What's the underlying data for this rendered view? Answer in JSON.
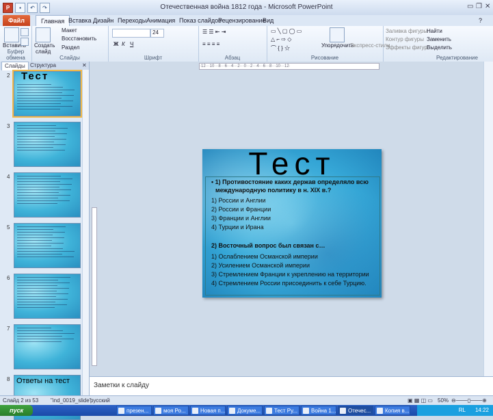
{
  "window": {
    "title": "Отечественная война 1812 года - Microsoft PowerPoint",
    "app_icon": "P"
  },
  "tabs": [
    "Файл",
    "Главная",
    "Вставка",
    "Дизайн",
    "Переходы",
    "Анимация",
    "Показ слайдов",
    "Рецензирование",
    "Вид"
  ],
  "ribbon": {
    "clipboard": {
      "label": "Буфер обмена",
      "paste": "Вставить"
    },
    "slides": {
      "label": "Слайды",
      "create": "Создать",
      "create2": "слайд",
      "layout": "Макет",
      "reset": "Восстановить",
      "section": "Раздел"
    },
    "font": {
      "label": "Шрифт",
      "size": "24"
    },
    "paragraph": {
      "label": "Абзац"
    },
    "drawing": {
      "label": "Рисование",
      "arrange": "Упорядочить",
      "quick_styles": "Экспресс-стили",
      "fill": "Заливка фигуры",
      "outline": "Контур фигуры",
      "effects": "Эффекты фигур"
    },
    "editing": {
      "label": "Редактирование",
      "find": "Найти",
      "replace": "Заменить",
      "select": "Выделить"
    }
  },
  "left_panel": {
    "tabs": [
      "Слайды",
      "Структура"
    ],
    "thumbnails": [
      {
        "num": "2",
        "title": "Тест",
        "lines": 10
      },
      {
        "num": "3",
        "title": "",
        "lines": 10
      },
      {
        "num": "4",
        "title": "",
        "lines": 11
      },
      {
        "num": "5",
        "title": "",
        "lines": 12
      },
      {
        "num": "6",
        "title": "",
        "lines": 12
      },
      {
        "num": "7",
        "title": "",
        "lines": 6
      },
      {
        "num": "8",
        "title": "Ответы на тест",
        "lines": 0
      }
    ]
  },
  "ruler": {
    "text": "·12···10···8···6···4···2···0···2···4···6···8···10···12·"
  },
  "slide": {
    "title": "Тест",
    "q1": "• 1) Противостояние каких держав определяло всю",
    "q1b": "международную политику в н. XIX в.?",
    "q1_options": [
      "1)  России и Англии",
      "2)  России и Франции",
      "3)  Франции и Англии",
      "4)  Турции и Ирана"
    ],
    "q2": "2) Восточный вопрос был связан с…",
    "q2_options": [
      "1)  Ослаблением Османской империи",
      "2)  Усилением Османской империи",
      "3)  Стремлением Франции к укреплению на территории",
      "4)  Стремлением России присоединить к себе Турцию."
    ]
  },
  "notes": {
    "placeholder": "Заметки к слайду"
  },
  "status": {
    "slide_of": "Слайд 2 из 53",
    "theme": "\"ind_0019_slide\"",
    "lang": "русский",
    "zoom": "50%"
  },
  "taskbar": {
    "start": "пуск",
    "items": [
      "презен...",
      "моя Ро...",
      "Новая п...",
      "Докуме...",
      "Тест Ру...",
      "Война 1...",
      "Отечес...",
      "Копия в..."
    ],
    "lang": "RL",
    "time": "14:22"
  }
}
